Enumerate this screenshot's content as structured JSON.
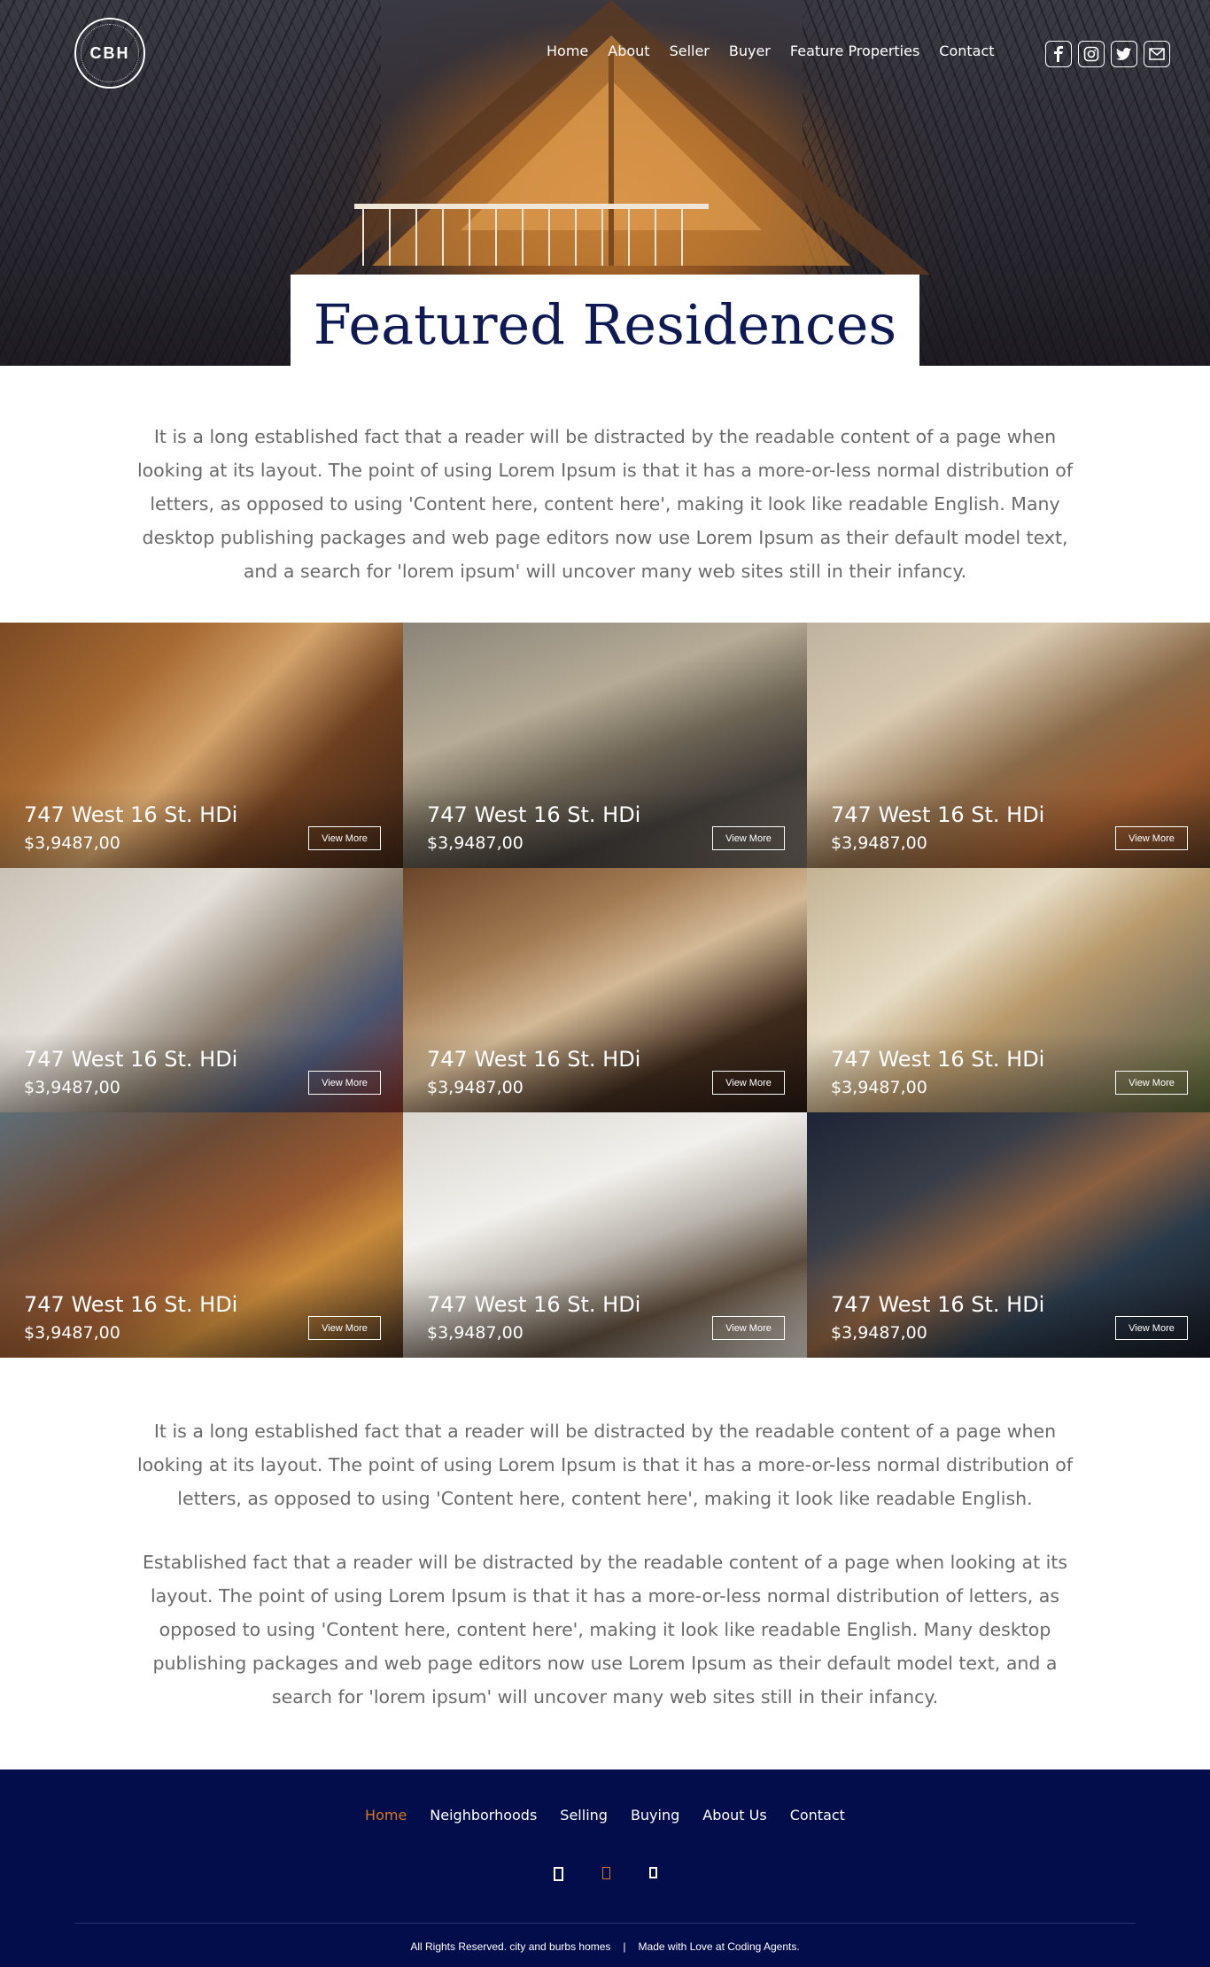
{
  "header": {
    "logo_text": "CBH",
    "nav": [
      "Home",
      "About",
      "Seller",
      "Buyer",
      "Feature Properties",
      "Contact"
    ],
    "social_icons": [
      "facebook-icon",
      "instagram-icon",
      "twitter-icon",
      "mail-icon"
    ],
    "page_title": "Featured Residences"
  },
  "intro": {
    "text": "It is a long established fact that a reader will be distracted by the readable content of a page when looking at its layout. The point of using Lorem Ipsum is that it has a more-or-less normal distribution of letters, as opposed to using 'Content here, content here', making it look like readable English. Many desktop publishing packages and web page editors now use Lorem Ipsum as their default model text, and a search for 'lorem ipsum' will uncover many web sites still in their infancy."
  },
  "listings": [
    {
      "address": "747 West 16 St. HDi",
      "price": "$3,9487,00",
      "button": "View More"
    },
    {
      "address": "747 West 16 St. HDi",
      "price": "$3,9487,00",
      "button": "View More"
    },
    {
      "address": "747 West 16 St. HDi",
      "price": "$3,9487,00",
      "button": "View More"
    },
    {
      "address": "747 West 16 St. HDi",
      "price": "$3,9487,00",
      "button": "View More"
    },
    {
      "address": "747 West 16 St. HDi",
      "price": "$3,9487,00",
      "button": "View More"
    },
    {
      "address": "747 West 16 St. HDi",
      "price": "$3,9487,00",
      "button": "View More"
    },
    {
      "address": "747 West 16 St. HDi",
      "price": "$3,9487,00",
      "button": "View More"
    },
    {
      "address": "747 West 16 St. HDi",
      "price": "$3,9487,00",
      "button": "View More"
    },
    {
      "address": "747 West 16 St. HDi",
      "price": "$3,9487,00",
      "button": "View More"
    }
  ],
  "body_text": {
    "p1": "It is a long established fact that a reader will be distracted by the readable content of a page when looking at its layout. The point of using Lorem Ipsum is that it has a more-or-less normal distribution of letters, as opposed to using 'Content here, content here', making it look like readable English.",
    "p2": "Established fact that a reader will be distracted by the readable content of a page when looking at its layout. The point of using Lorem Ipsum is that it has a more-or-less normal distribution of letters, as opposed to using 'Content here, content here', making it look like readable English. Many desktop publishing packages and web page editors now use Lorem Ipsum as their default model text, and a search for 'lorem ipsum' will uncover many web sites still in their infancy."
  },
  "footer": {
    "nav": [
      "Home",
      "Neighborhoods",
      "Selling",
      "Buying",
      "About Us",
      "Contact"
    ],
    "active": "Home",
    "copyright": "All Rights Reserved. city and burbs homes",
    "separator": "|",
    "credit": "Made with Love at Coding Agents."
  },
  "colors": {
    "navy": "#040d4b",
    "title_navy": "#0f1a55",
    "accent_orange": "#d47a1e"
  }
}
